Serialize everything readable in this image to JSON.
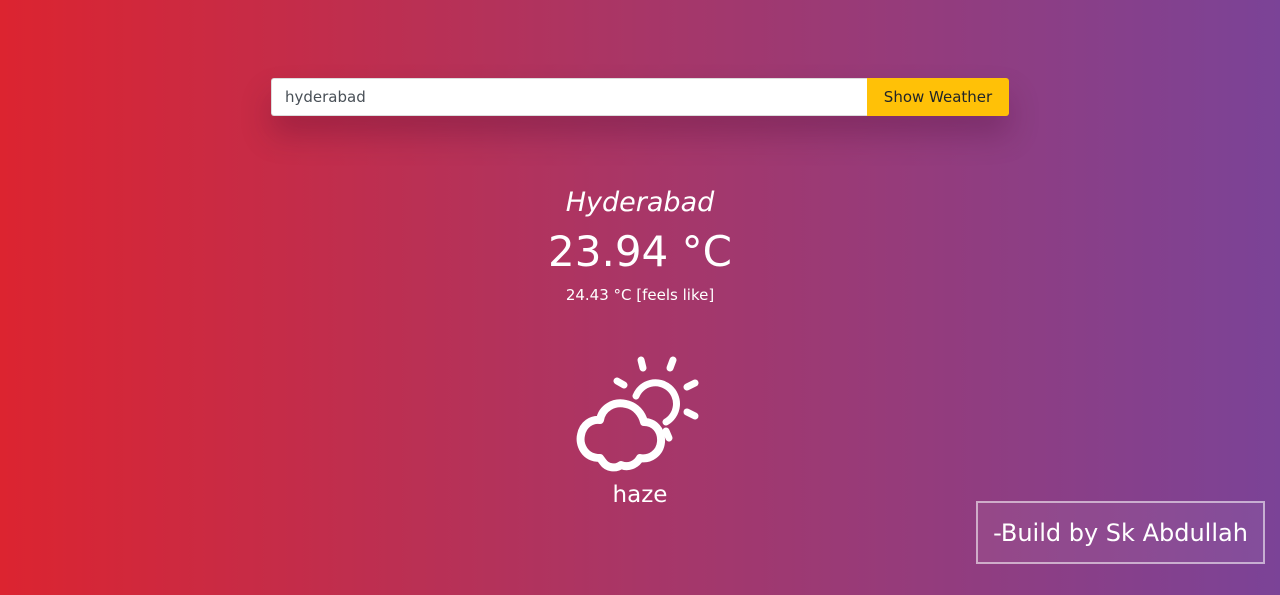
{
  "search": {
    "value": "hyderabad",
    "button_label": "Show Weather"
  },
  "weather": {
    "city": "Hyderabad",
    "temperature": "23.94 °C",
    "feels_like": "24.43 °C [feels like]",
    "icon": "partly-cloudy-icon",
    "description": "haze"
  },
  "footer": {
    "credit": "-Build by Sk Abdullah"
  },
  "colors": {
    "gradient_start": "#dc2430",
    "gradient_end": "#7b4397",
    "button": "#ffc107"
  }
}
